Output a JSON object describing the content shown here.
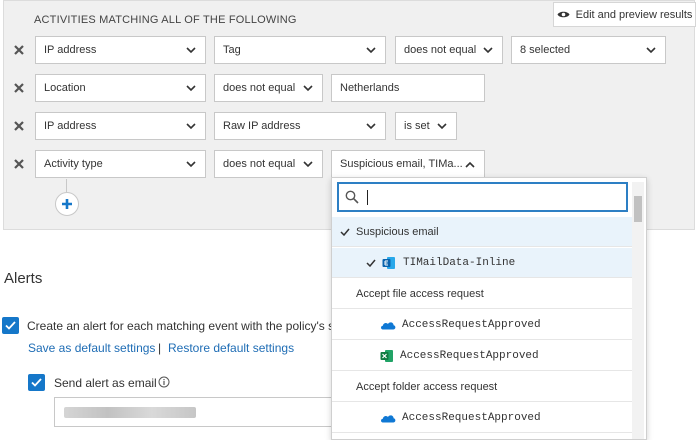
{
  "panel": {
    "heading": "ACTIVITIES MATCHING ALL OF THE FOLLOWING",
    "preview_button": "Edit and preview results",
    "rows": [
      {
        "field": "IP address",
        "operator": "Tag",
        "condition": "does not equal",
        "value": "8 selected"
      },
      {
        "field": "Location",
        "condition": "does not equal",
        "value": "Netherlands"
      },
      {
        "field": "IP address",
        "operator": "Raw IP address",
        "condition": "is set"
      },
      {
        "field": "Activity type",
        "condition": "does not equal",
        "value": "Suspicious email, TIMa..."
      }
    ]
  },
  "dropdown": {
    "search_value": "",
    "items": [
      {
        "label": "Suspicious email",
        "kind": "group",
        "selected": true
      },
      {
        "label": "TIMailData-Inline",
        "kind": "app",
        "icon": "exchange-icon",
        "selected": true
      },
      {
        "label": "Accept file access request",
        "kind": "group",
        "selected": false
      },
      {
        "label": "AccessRequestApproved",
        "kind": "app",
        "icon": "onedrive-icon",
        "selected": false
      },
      {
        "label": "AccessRequestApproved",
        "kind": "app",
        "icon": "excel-icon",
        "selected": false
      },
      {
        "label": "Accept folder access request",
        "kind": "group",
        "selected": false
      },
      {
        "label": "AccessRequestApproved",
        "kind": "app",
        "icon": "onedrive-icon",
        "selected": false
      }
    ]
  },
  "alerts": {
    "heading": "Alerts",
    "create_alert_label": "Create an alert for each matching event with the policy's s",
    "create_alert_checked": true,
    "save_default": "Save as default settings",
    "separator": "|",
    "restore_default": "Restore default settings",
    "send_email_label": "Send alert as email",
    "send_email_checked": true,
    "info_icon": "info-icon"
  },
  "colors": {
    "accent": "#1577c9",
    "link": "#1f6db5",
    "panel_bg": "#f0f0f0",
    "selected_row": "#e9f3fb"
  }
}
